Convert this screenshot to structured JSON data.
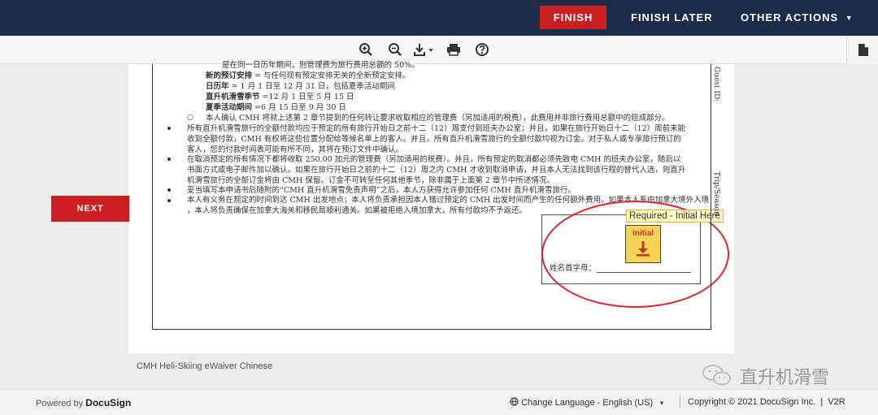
{
  "header": {
    "finish_label": "FINISH",
    "finish_later_label": "FINISH LATER",
    "other_actions_label": "OTHER ACTIONS"
  },
  "toolbar": {
    "icons": [
      "zoom-in-icon",
      "zoom-out-icon",
      "download-icon",
      "print-icon",
      "help-icon",
      "document-icon"
    ]
  },
  "document": {
    "lines": [
      "是在同一日历年期间，则管理费为旅行费用总额的 50%。",
      "新的预订安排 = 与任何现有预定安排无关的全新预定安排。",
      "日历年 = 1 月 1 日至 12 月 31 日，包括夏季活动期间",
      "直升机滑雪季节 =12 月 1 日至 5 月 15 日",
      "夏季活动期间 =6 月 15 日至 9 月 30 日",
      "本人确认 CMH 将就上述第 2 章节提到的任何转让要求收取相应的管理费（另加适用的税费），此费用并非旅行费用总额中的组成部分。",
      "所有直升机滑雪旅行的全额付款均应于预定的所有旅行开始日之前十二（12）周支付到班夫办公室；并且，如果在旅行开始日十二（12）周前未能",
      "收到全额付款，CMH 有权将这些位置分配给等候名单上的客人。并且，所有直升机滑雪旅行的全额付款均视为订金。对于私人或专享旅行预订的",
      "客人，您的付款时间表可能有所不同，其将在预订文件中确认。",
      "在取消预定的所有情况下都将收取 250.00 加元的管理费（另加适用的税费）。并且，所有预定的取消都必须先致电 CMH 的班夫办公室，随后以",
      "书面方式或电子邮件加以确认。如果在旅行开始日之前的十二（12）周之内 CMH 才收到取消申请，并且本人无法找到该行程的替代人选，则直升",
      "机滑雪旅行的全部订金将由 CMH 保留。订金不可转至任何其他季节，除非属于上面第 2 章节中所述情况。",
      "妥当填写本申请书后随附的“CMH 直升机滑雪免责声明”之后，本人方获得允许参加任何 CMH 直升机滑雪旅行。",
      "本人有义务在规定的时间到达 CMH 出发地点；本人将负责承担因本人错过预定的 CMH 出发时间而产生的任何额外费用。如果本人系由加拿大境外入境",
      "，本人将负责确保在加拿大海关和移民局顺利通关。如果被拒绝入境加拿大，所有付款均不予返还。"
    ],
    "initials_label": "姓名首字母：",
    "margin_guest_id": "Guest ID:",
    "margin_trip_season": "Trip/Season"
  },
  "sign_tag": {
    "text": "Required - Initial Here",
    "initial_button": "Initial",
    "icon": "down-arrow-icon"
  },
  "nav": {
    "next_label": "NEXT"
  },
  "doc_name": "CMH Heli-Skiing eWaiver Chinese",
  "watermark": {
    "text": "直升机滑雪",
    "icon": "wechat-icon"
  },
  "footer": {
    "powered_by": "Powered by",
    "brand": "DocuSign",
    "change_language": "Change Language - English (US)",
    "copyright": "Copyright © 2021 DocuSign Inc.",
    "version": "V2R"
  },
  "colors": {
    "header_bg": "#1b2b4a",
    "action_red": "#cc1d20",
    "tag_yellow": "#fffdc6",
    "initial_yellow": "#f6d356",
    "annotation_red": "#e0242a"
  }
}
